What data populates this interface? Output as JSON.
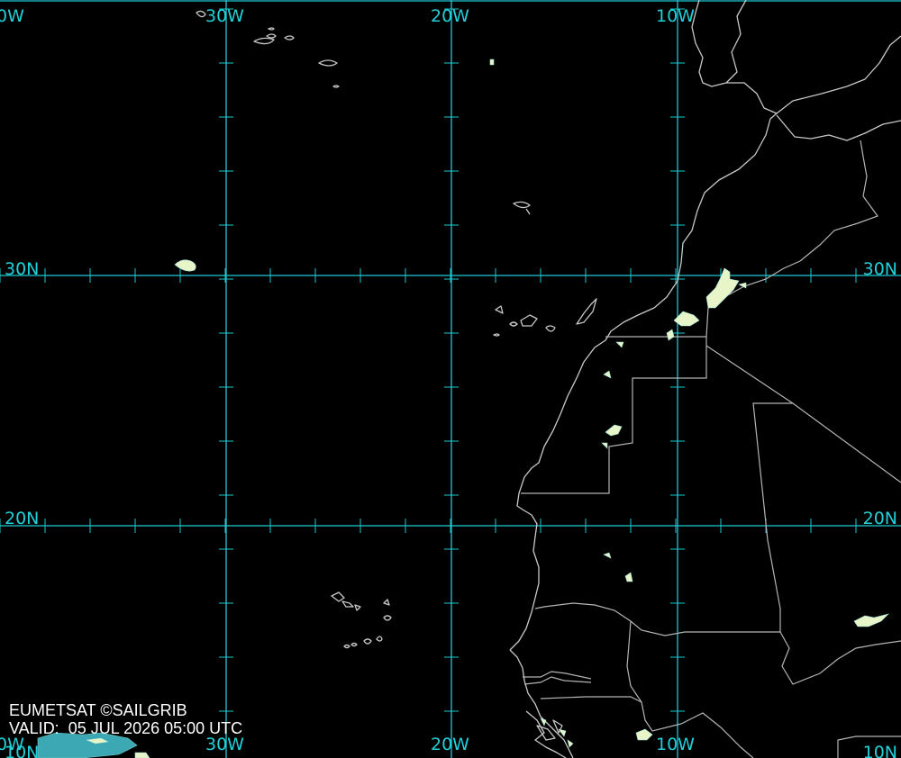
{
  "map": {
    "background": "#000000",
    "grid_color": "#1ec8d2",
    "coast_color": "#c8c8c8",
    "cloud_color": "#e8f5c8",
    "top_longitude_labels": [
      "0W",
      "30W",
      "20W",
      "10W"
    ],
    "bottom_longitude_labels": [
      "0W",
      "30W",
      "20W",
      "10W"
    ],
    "left_latitude_labels": [
      "30N",
      "20N",
      "10N"
    ],
    "right_latitude_labels": [
      "30N",
      "20N",
      "10N"
    ]
  },
  "credit": {
    "source": "EUMETSAT ©SAILGRIB",
    "valid_prefix": "VALID:",
    "valid_time": "05 JUL 2026 05:00 UTC"
  }
}
